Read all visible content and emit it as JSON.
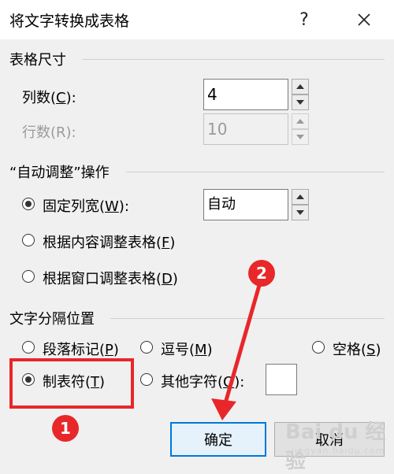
{
  "dialog": {
    "title": "将文字转换成表格",
    "help_button": "?",
    "close_button": "✕"
  },
  "table_size": {
    "heading": "表格尺寸",
    "columns_label_prefix": "列数(",
    "columns_label_key": "C",
    "columns_label_suffix": "):",
    "columns_value": "4",
    "rows_label": "行数(R):",
    "rows_value": "10"
  },
  "autofit": {
    "heading": "“自动调整”操作",
    "fixed_width_prefix": "固定列宽(",
    "fixed_width_key": "W",
    "fixed_width_suffix": "):",
    "fixed_width_value": "自动",
    "fit_content_prefix": "根据内容调整表格(",
    "fit_content_key": "F",
    "fit_content_suffix": ")",
    "fit_window_prefix": "根据窗口调整表格(",
    "fit_window_key": "D",
    "fit_window_suffix": ")"
  },
  "separator": {
    "heading": "文字分隔位置",
    "paragraph_prefix": "段落标记(",
    "paragraph_key": "P",
    "paragraph_suffix": ")",
    "comma_prefix": "逗号(",
    "comma_key": "M",
    "comma_suffix": ")",
    "space_prefix": "空格(",
    "space_key": "S",
    "space_suffix": ")",
    "tab_prefix": "制表符(",
    "tab_key": "T",
    "tab_suffix": ")",
    "other_prefix": "其他字符(",
    "other_key": "O",
    "other_suffix": "):",
    "other_value": ""
  },
  "buttons": {
    "ok": "确定",
    "cancel": "取消"
  },
  "annotations": {
    "step1": "1",
    "step2": "2",
    "color": "#e8272a"
  },
  "watermark": {
    "text": "Bai du 经验",
    "url": "jingyan.baidu.com"
  },
  "selected": {
    "autofit": "fixed_width",
    "separator": "tab"
  }
}
